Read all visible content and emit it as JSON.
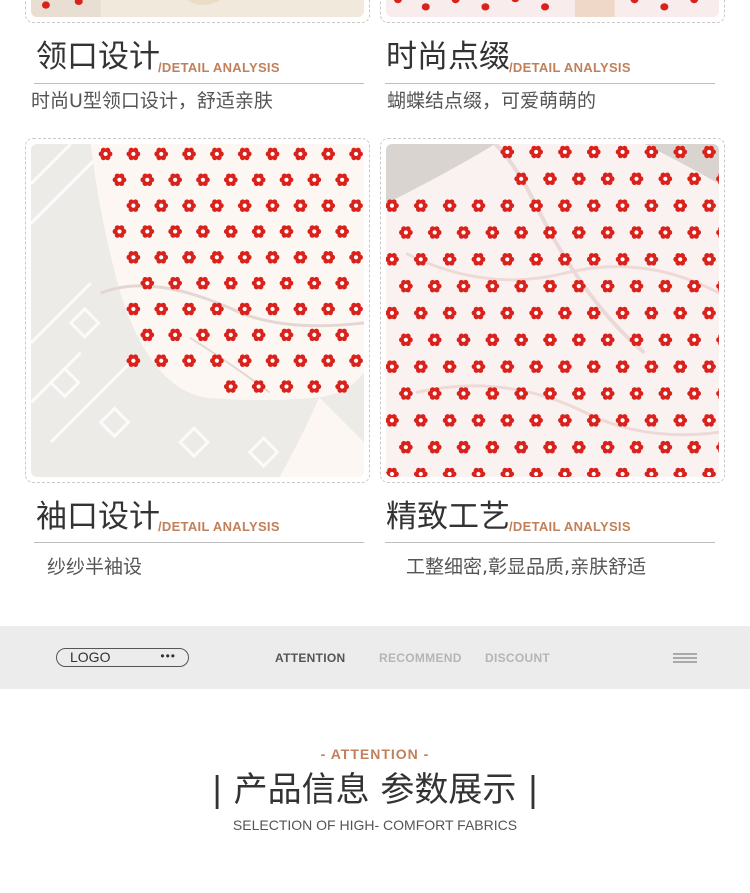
{
  "features": [
    {
      "title": "领口设计",
      "tag": "/DETAIL ANALYSIS",
      "desc": "时尚U型领口设计，舒适亲肤"
    },
    {
      "title": "时尚点缀",
      "tag": "/DETAIL ANALYSIS",
      "desc": "蝴蝶结点缀，可爱萌萌的"
    },
    {
      "title": "袖口设计",
      "tag": "/DETAIL ANALYSIS",
      "desc": "纱纱半袖设"
    },
    {
      "title": "精致工艺",
      "tag": "/DETAIL ANALYSIS",
      "desc": "工整细密,彰显品质,亲肤舒适"
    }
  ],
  "nav": {
    "logo": "LOGO",
    "logo_dots": "•••",
    "items": [
      {
        "label": "ATTENTION",
        "active": true
      },
      {
        "label": "RECOMMEND",
        "active": false
      },
      {
        "label": "DISCOUNT",
        "active": false
      }
    ],
    "menu_icon": "hamburger-menu-icon"
  },
  "section": {
    "eyebrow": "- ATTENTION -",
    "title": "| 产品信息 参数展示 |",
    "subtitle": "SELECTION OF HIGH- COMFORT FABRICS"
  },
  "colors": {
    "accent": "#c1805a",
    "print_red": "#d9221c",
    "nav_bg": "#ececec"
  }
}
